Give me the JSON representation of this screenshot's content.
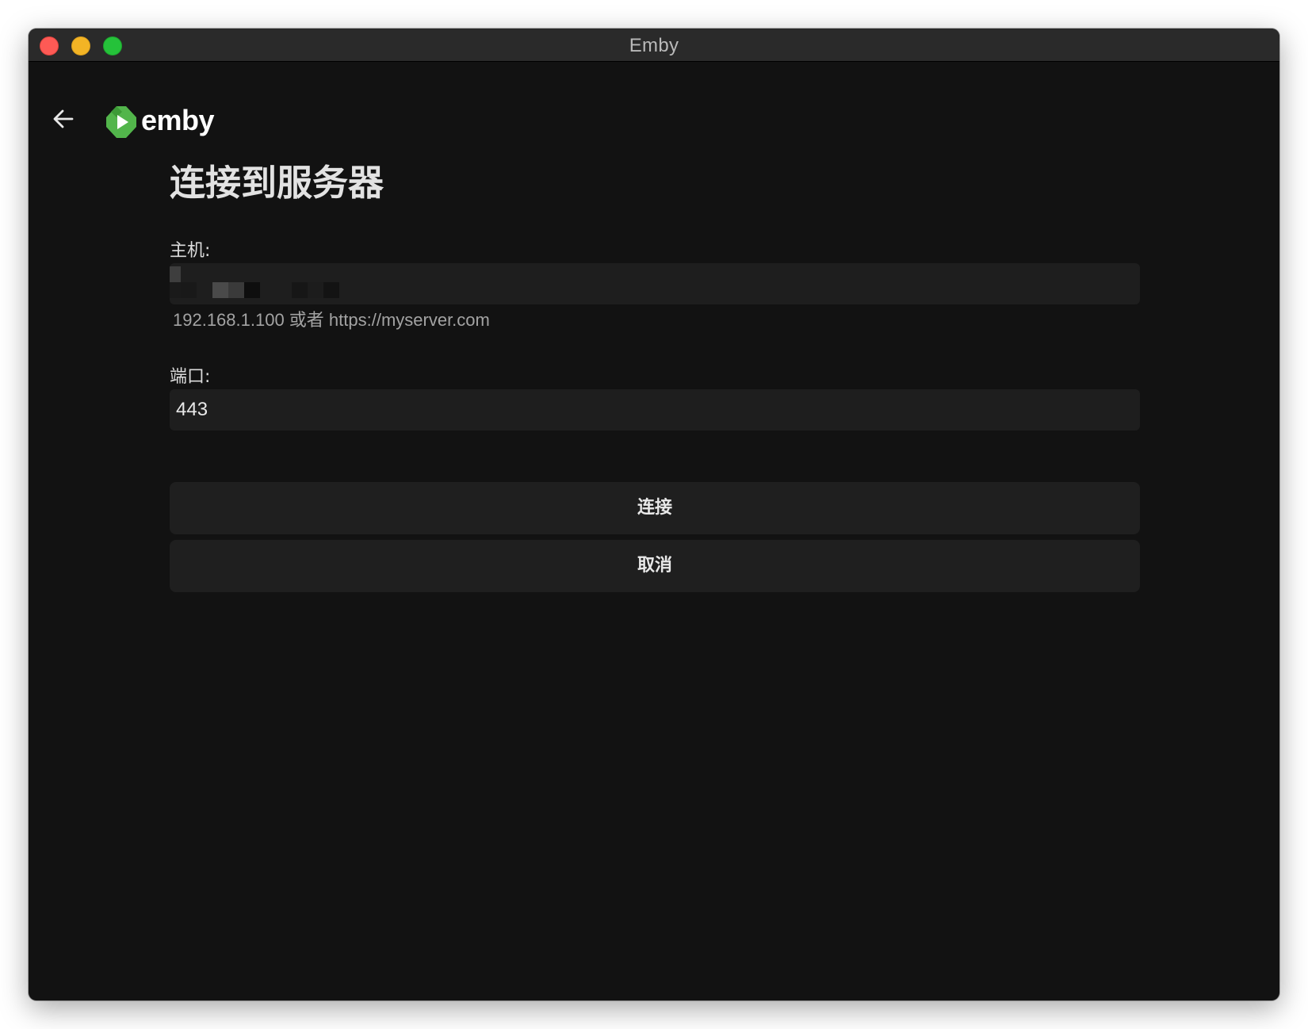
{
  "window": {
    "title": "Emby"
  },
  "header": {
    "back_icon": "arrow-left-icon",
    "logo_text": "emby",
    "logo_color": "#52b54b"
  },
  "form": {
    "title": "连接到服务器",
    "host": {
      "label": "主机:",
      "value": "",
      "value_redacted": true,
      "hint": "192.168.1.100 或者 https://myserver.com"
    },
    "port": {
      "label": "端口:",
      "value": "443"
    },
    "connect_label": "连接",
    "cancel_label": "取消"
  },
  "colors": {
    "background": "#121212",
    "input_background": "#1e1e1e",
    "button_background": "#1f1f1f",
    "accent": "#52b54b"
  }
}
